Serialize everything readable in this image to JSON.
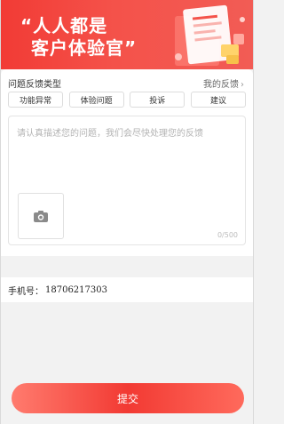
{
  "banner": {
    "line1": "“人人都是",
    "line2": "客户体验官”"
  },
  "feedback": {
    "type_title": "问题反馈类型",
    "my_feedback_label": "我的反馈",
    "types": [
      "功能异常",
      "体验问题",
      "投诉",
      "建议"
    ],
    "placeholder": "请认真描述您的问题，我们会尽快处理您的反馈",
    "counter": "0/500"
  },
  "phone": {
    "label": "手机号：",
    "value": "18706217303"
  },
  "submit_label": "提交",
  "colors": {
    "brand_red": "#f23a33",
    "background": "#f2f2f2"
  }
}
